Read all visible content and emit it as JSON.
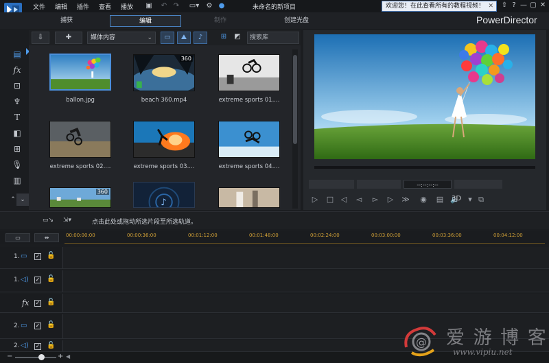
{
  "menubar": {
    "items": [
      "文件",
      "编辑",
      "插件",
      "查看",
      "播放"
    ],
    "project_title": "未命名的新项目",
    "notice": "欢迎您！在此查看所有的教程视频！",
    "help": "?"
  },
  "modes": [
    {
      "label": "捕获",
      "state": "normal"
    },
    {
      "label": "编辑",
      "state": "active"
    },
    {
      "label": "制作",
      "state": "disabled"
    },
    {
      "label": "创建光盘",
      "state": "normal"
    }
  ],
  "app_name": "PowerDirector",
  "library": {
    "media_select": "媒体内容",
    "search_placeholder": "搜索库",
    "items": [
      {
        "label": "ballon.jpg",
        "badge": "",
        "selected": true
      },
      {
        "label": "beach 360.mp4",
        "badge": "360",
        "selected": false
      },
      {
        "label": "extreme sports 01....",
        "badge": "",
        "selected": false
      },
      {
        "label": "extreme sports 02....",
        "badge": "",
        "selected": false
      },
      {
        "label": "extreme sports 03....",
        "badge": "",
        "selected": false
      },
      {
        "label": "extreme sports 04....",
        "badge": "",
        "selected": false
      },
      {
        "label": "",
        "badge": "360",
        "selected": false
      },
      {
        "label": "",
        "badge": "",
        "selected": false
      },
      {
        "label": "",
        "badge": "",
        "selected": false
      }
    ]
  },
  "preview": {
    "timecode": "--:--:--:--",
    "mode_3d": "3D"
  },
  "timeline": {
    "hint": "点击此处或拖动所选片段至所选轨道。",
    "ruler_ticks": [
      "00:00:00:00",
      "00:00:36:00",
      "00:01:12:00",
      "00:01:48:00",
      "00:02:24:00",
      "00:03:00:00",
      "00:03:36:00",
      "00:04:12:00"
    ],
    "tracks": [
      {
        "num": "1.",
        "type": "video"
      },
      {
        "num": "1.",
        "type": "audio"
      },
      {
        "num": "",
        "type": "fx"
      },
      {
        "num": "2.",
        "type": "video"
      },
      {
        "num": "2.",
        "type": "audio"
      }
    ]
  },
  "watermark": {
    "text": "爱 游 博 客",
    "url": "www.vipiu.net"
  },
  "colors": {
    "accent": "#4f9bea",
    "ruler": "#d6a437",
    "background": "#1b1d20"
  }
}
